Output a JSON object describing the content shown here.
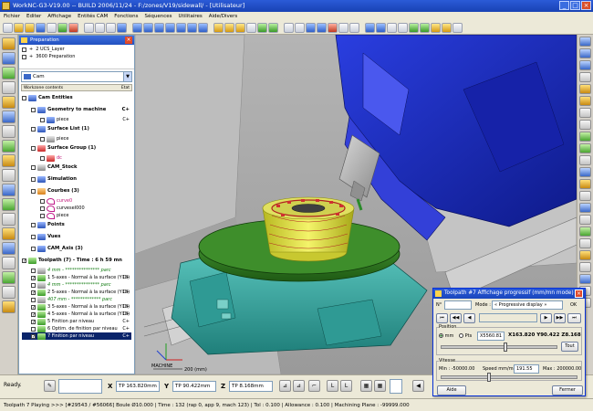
{
  "window": {
    "title": "WorkNC-G3-V19.00 -- BUILD 2006/11/24 - F:/zones/V19/sidewall/ - [Utilisateur]",
    "buttons": [
      "_",
      "□",
      "×"
    ]
  },
  "menu": [
    "Fichier",
    "Editer",
    "Affichage",
    "Entités CAM",
    "Fonctions",
    "Séquences",
    "Utilitaires",
    "Aide/Divers"
  ],
  "panel": {
    "title": "Preparation",
    "prep_items": [
      {
        "mark": "+",
        "label": "2 UCS_Layer"
      },
      {
        "mark": "+",
        "label": "3600 Preparation"
      }
    ],
    "combo_value": "Cam",
    "col_left": "Workzone contents",
    "col_right": "Etat",
    "tree": [
      {
        "label": "Cam Entities",
        "bold": true,
        "icon": "blue",
        "status": ""
      },
      {
        "label": "Geometry to machine",
        "bold": true,
        "icon": "blue",
        "status": "C+",
        "indent": 1
      },
      {
        "label": "piece",
        "icon": "blue",
        "status": "C+",
        "indent": 2
      },
      {
        "label": "Surface List (1)",
        "bold": true,
        "icon": "blue",
        "status": "",
        "indent": 1
      },
      {
        "label": "piece",
        "icon": "gray",
        "status": "",
        "indent": 2
      },
      {
        "label": "Surface Group (1)",
        "bold": true,
        "icon": "red",
        "status": "",
        "indent": 1
      },
      {
        "label": "dc",
        "icon": "red",
        "status": "",
        "indent": 2,
        "pink": true
      },
      {
        "label": "CAM_Stock",
        "bold": true,
        "icon": "gray",
        "status": "",
        "indent": 1
      },
      {
        "label": "Simulation",
        "bold": true,
        "icon": "blue",
        "status": "",
        "indent": 1
      },
      {
        "label": "Courbes (3)",
        "bold": true,
        "icon": "orange",
        "status": "",
        "indent": 1
      },
      {
        "label": "curve0",
        "icon": "curve",
        "status": "",
        "indent": 2,
        "pink": true
      },
      {
        "label": "curvesel000",
        "icon": "curve",
        "status": "",
        "indent": 2
      },
      {
        "label": "piece",
        "icon": "curve",
        "status": "",
        "indent": 2
      },
      {
        "label": "Points",
        "bold": true,
        "icon": "blue",
        "status": "",
        "indent": 1
      },
      {
        "label": "Vues",
        "bold": true,
        "icon": "blue",
        "status": "",
        "indent": 1
      },
      {
        "label": "CAM_Axis (3)",
        "bold": true,
        "icon": "blue",
        "status": "",
        "indent": 1
      }
    ],
    "toolpaths_header": "Toolpath (7) - Time : 6 h 59 mn",
    "toolpaths": [
      {
        "label": "4 mm - *************** parc",
        "sep": true,
        "status": ""
      },
      {
        "label": "1 5-axes - Normal à la surface (Y18)",
        "status": "C+",
        "check": true
      },
      {
        "label": "4 mm - *************** parc",
        "sep": true,
        "status": ""
      },
      {
        "label": "2 5-axes - Normal à la surface (Y18)",
        "status": "C+",
        "check": true
      },
      {
        "label": "407 mm - ************* parc",
        "sep": true,
        "status": ""
      },
      {
        "label": "3 5-axes - Normal à la surface (Y18)",
        "status": "C+",
        "check": true
      },
      {
        "label": "4 5-axes - Normal à la surface (Y18)",
        "status": "C+",
        "check": true
      },
      {
        "label": "5 Finition par niveau",
        "status": "C+",
        "check": true
      },
      {
        "label": "6 Optim. de finition par niveau",
        "status": "C+",
        "check": false
      },
      {
        "label": "7 Finition par niveau",
        "status": "C+",
        "check": true,
        "selected": true
      }
    ]
  },
  "viewport": {
    "axis_label": "MACHINE",
    "scale_label": "200 (mm)"
  },
  "bottom": {
    "status": "Ready.",
    "x_label": "X",
    "x_value": "TP 163.820mm",
    "y_label": "Y",
    "y_value": "TP 90.422mm",
    "z_label": "Z",
    "z_value": "TP 8.168mm",
    "view_letters": [
      "L",
      "L"
    ]
  },
  "statusline": "Toolpath 7   Playing >>> [#29543 / #56066]  Boule Ø10.000 | Time : 132 (rap 0, app 9, mach 123) | Tol : 0.100 | Allowance : 0.100 | Machining Plane : -99999.000",
  "dialog": {
    "title": "Toolpath #7 Affichage progressif (mm/mn mode)",
    "n_label": "N°",
    "mode_label": "Mode :",
    "mode_value": "« Progressive display »",
    "ok_label": "OK",
    "position_group": "Position",
    "mm_label": "mm",
    "pts_label": "Pts",
    "pts_value": "X5560.81",
    "coords": "X163.820  Y90.422  Z8.168",
    "tout_label": "Tout",
    "speed_group": "Vitesse",
    "min_label": "Min : -50000.00",
    "speed_label": "Speed mm/mn",
    "speed_value": "191.55",
    "max_label": "Max : 200000.00",
    "aide_label": "Aide",
    "fermer_label": "Fermer"
  },
  "colors": {
    "title_blue": "#2b5bd7",
    "machine_blue": "#1f2fc8",
    "table_teal": "#3aa8a0",
    "table_green": "#3f8f2a",
    "part_yellow": "#e8e84a"
  }
}
